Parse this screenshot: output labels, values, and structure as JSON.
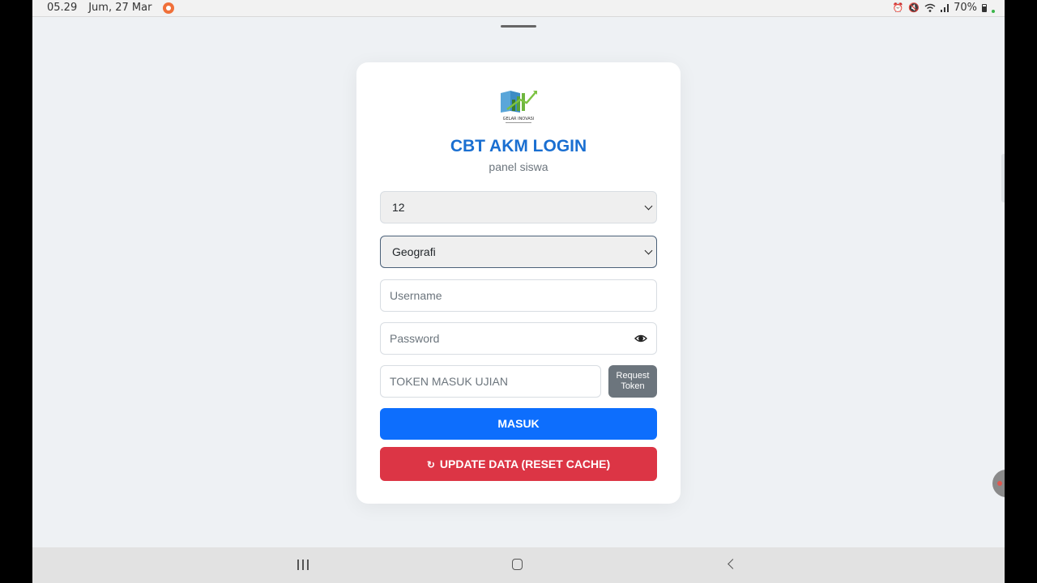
{
  "status_bar": {
    "time": "05.29",
    "date": "Jum, 27 Mar",
    "battery": "70%",
    "icons": [
      "alarm-icon",
      "mute-icon",
      "wifi-icon",
      "signal-icon",
      "battery-icon"
    ]
  },
  "login": {
    "logo_icon": "gelar-inovasi-logo",
    "logo_text": "GELAR INOVASI",
    "title": "CBT AKM LOGIN",
    "subtitle": "panel siswa",
    "class_select": {
      "value": "12"
    },
    "subject_select": {
      "value": "Geografi"
    },
    "username": {
      "placeholder": "Username"
    },
    "password": {
      "placeholder": "Password",
      "toggle_icon": "eye-icon"
    },
    "token": {
      "placeholder": "TOKEN MASUK UJIAN"
    },
    "request_token_label_line1": "Request",
    "request_token_label_line2": "Token",
    "masuk_label": "MASUK",
    "update_icon": "refresh-icon",
    "update_symbol": "↻",
    "update_label": "UPDATE DATA (RESET CACHE)"
  },
  "colors": {
    "title": "#1a6fd1",
    "primary": "#0d6efd",
    "danger": "#dc3545",
    "secondary": "#6c757d",
    "background": "#eef1f4"
  },
  "nav_bar": {
    "icons": [
      "recent-apps-icon",
      "home-icon",
      "back-icon"
    ]
  }
}
